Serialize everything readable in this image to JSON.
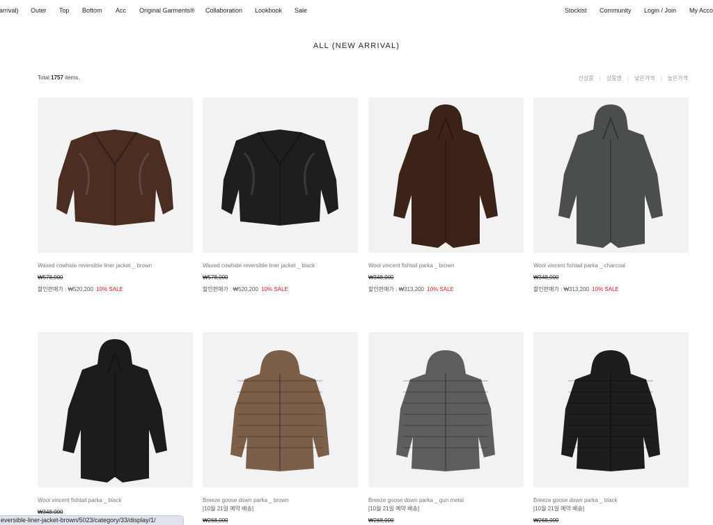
{
  "nav": {
    "left": [
      "arrival)",
      "Outer",
      "Top",
      "Bottom",
      "Acc",
      "Original Garments®",
      "Collaboration",
      "Lookbook",
      "Sale"
    ],
    "right": [
      "Stockist",
      "Community",
      "Login / Join",
      "My Acco"
    ]
  },
  "page": {
    "title": "ALL (NEW ARRIVAL)"
  },
  "listing": {
    "total_prefix": "Total",
    "total_count": "1757",
    "total_suffix": "items."
  },
  "sort_options": [
    "신상품",
    "상품명",
    "낮은가격",
    "높은가격"
  ],
  "colors": {
    "sale": "#e02020",
    "image_bg": "#f2f2f2"
  },
  "products": [
    {
      "name": "Waxed cowhide reversible liner jacket _ brown",
      "note": "",
      "original_price": "₩578,000",
      "sale_label": "할인판매가 : ₩520,200",
      "sale_pct": "10% SALE",
      "icon": "leather-liner-jacket",
      "color": "#4a2e22"
    },
    {
      "name": "Waxed cowhide reversible liner jacket _ black",
      "note": "",
      "original_price": "₩578,000",
      "sale_label": "할인판매가 : ₩520,200",
      "sale_pct": "10% SALE",
      "icon": "leather-liner-jacket",
      "color": "#1e1e1e"
    },
    {
      "name": "Wool vincent fishtail parka _ brown",
      "note": "",
      "original_price": "₩348,000",
      "sale_label": "할인판매가 : ₩313,200",
      "sale_pct": "10% SALE",
      "icon": "fishtail-parka",
      "color": "#3b2318"
    },
    {
      "name": "Wool vincent fishtail parka _ charcoal",
      "note": "",
      "original_price": "₩348,000",
      "sale_label": "할인판매가 : ₩313,200",
      "sale_pct": "10% SALE",
      "icon": "fishtail-parka",
      "color": "#4a4e4f"
    },
    {
      "name": "Wool vincent fishtail parka _ black",
      "note": "",
      "original_price": "₩348,000",
      "sale_label": "",
      "sale_pct": "",
      "icon": "fishtail-parka",
      "color": "#1c1c1c"
    },
    {
      "name": "Breeze goose down parka _ brown",
      "note": "[10월 21일 예약 배송]",
      "original_price": "₩268,000",
      "sale_label": "",
      "sale_pct": "",
      "icon": "puffer-jacket",
      "color": "#7a5f4a"
    },
    {
      "name": "Breeze goose down parka _ gun metal",
      "note": "[10월 21일 예약 배송]",
      "original_price": "₩268,000",
      "sale_label": "",
      "sale_pct": "",
      "icon": "puffer-jacket",
      "color": "#5c5e60"
    },
    {
      "name": "Breeze goose down parka _ black",
      "note": "[10월 21일 예약 배송]",
      "original_price": "₩268,000",
      "sale_label": "",
      "sale_pct": "",
      "icon": "puffer-jacket",
      "color": "#1d1d1d"
    }
  ],
  "status_bar": {
    "url": "eversible-liner-jacket-brown/5023/category/33/display/1/"
  }
}
